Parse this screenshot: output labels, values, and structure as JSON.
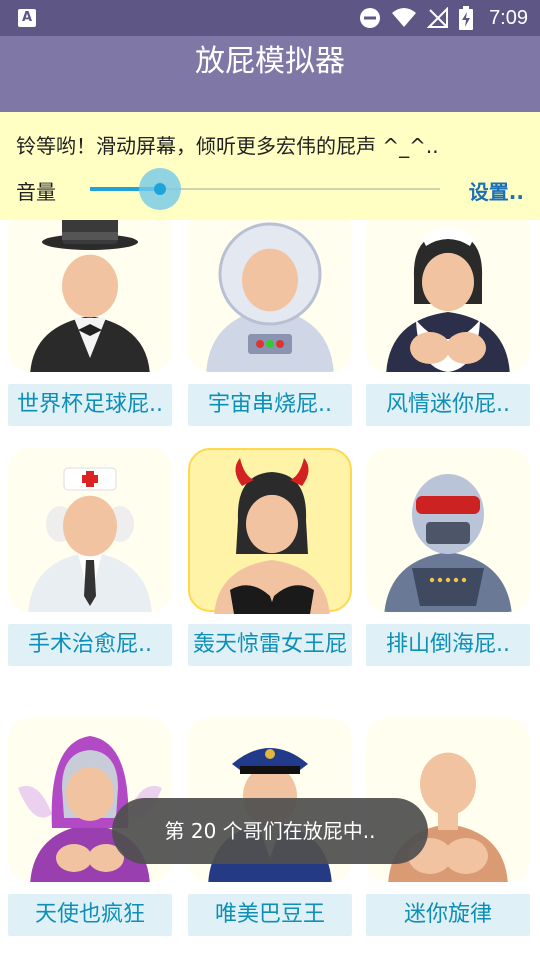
{
  "status_bar": {
    "time": "7:09",
    "left_icon": "A",
    "icons": [
      "dnd-icon",
      "wifi-icon",
      "no-signal-icon",
      "battery-charging-icon"
    ]
  },
  "app": {
    "title": "放屁模拟器"
  },
  "panel": {
    "marquee": "铃等哟！滑动屏幕，倾听更多宏伟的屁声 ^_^..",
    "volume_label": "音量",
    "volume_level": 0.2,
    "settings_label": "设置.."
  },
  "items": [
    {
      "name": "top-hat-gentleman",
      "label": "世界杯足球屁..",
      "selected": false
    },
    {
      "name": "astronaut",
      "label": "宇宙串烧屁..",
      "selected": false
    },
    {
      "name": "maid",
      "label": "风情迷你屁..",
      "selected": false
    },
    {
      "name": "doctor",
      "label": "手术治愈屁..",
      "selected": false
    },
    {
      "name": "devil-woman",
      "label": "轰天惊雷女王屁",
      "selected": true
    },
    {
      "name": "robot",
      "label": "排山倒海屁..",
      "selected": false
    },
    {
      "name": "angel-woman",
      "label": "天使也疯狂",
      "selected": false
    },
    {
      "name": "police-officer",
      "label": "唯美巴豆王",
      "selected": false
    },
    {
      "name": "plain-woman",
      "label": "迷你旋律",
      "selected": false
    }
  ],
  "toast": {
    "text": "第 20 个哥们在放屁中.."
  },
  "colors": {
    "status_bar": "#5e5785",
    "app_bar": "#7f77a6",
    "panel": "#ffffc4",
    "accent": "#1fa3d9",
    "label_bg": "#dff1f6",
    "label_text": "#0d8fb8"
  }
}
